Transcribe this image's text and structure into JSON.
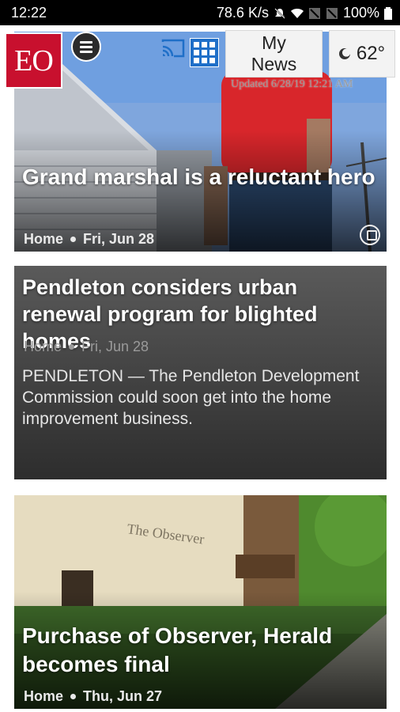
{
  "status_bar": {
    "time": "12:22",
    "network_speed": "78.6 K/s",
    "battery": "100%"
  },
  "header": {
    "logo_text": "EO",
    "logo_color": "#c8102e",
    "my_news_label_line1": "My",
    "my_news_label_line2": "News",
    "weather_temp": "62°",
    "updated_text": "Updated 6/28/19 12:21 AM"
  },
  "articles": [
    {
      "headline": "Grand marshal is a reluctant hero",
      "section": "Home",
      "date": "Fri, Jun 28",
      "has_gallery": true
    },
    {
      "headline": "Pendleton considers urban renewal program for blighted homes",
      "section": "Home",
      "date": "Fri, Jun 28",
      "summary": "PENDLETON — The Pendleton Development Commission could soon get into the home improvement business."
    },
    {
      "headline": "Purchase of Observer, Herald becomes final",
      "section": "Home",
      "date": "Thu, Jun 27"
    }
  ]
}
